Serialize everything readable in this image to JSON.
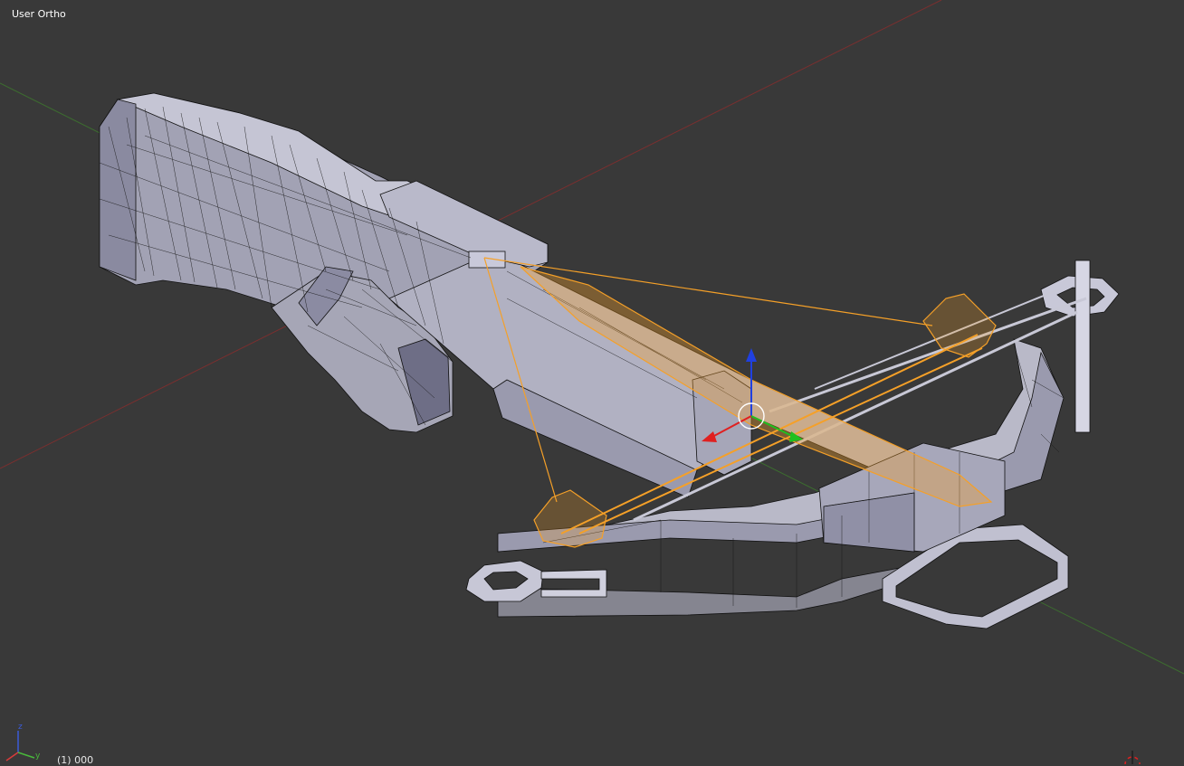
{
  "viewport": {
    "view_label": "User Ortho",
    "object_info": "(1) 000",
    "background": "#393939"
  },
  "axes_gizmo": {
    "labels": {
      "x": "x",
      "y": "y",
      "z": "z"
    },
    "colors": {
      "x": "#d83b3b",
      "y": "#49b83b",
      "z": "#3b5bd8"
    }
  },
  "colors": {
    "mesh_face": "#a8a8b8",
    "mesh_face_dark": "#7c7c90",
    "mesh_face_light": "#c9c9d8",
    "wire": "#111111",
    "selection": "#f5a028",
    "floor_x_axis": "#7a2f2f",
    "floor_y_axis": "#3c6e2f",
    "manipulator_x": "#e02020",
    "manipulator_y": "#20c020",
    "manipulator_z": "#2040e0"
  },
  "icons": [
    "axes-gizmo-icon",
    "3d-cursor-icon",
    "transform-manipulator-icon"
  ]
}
